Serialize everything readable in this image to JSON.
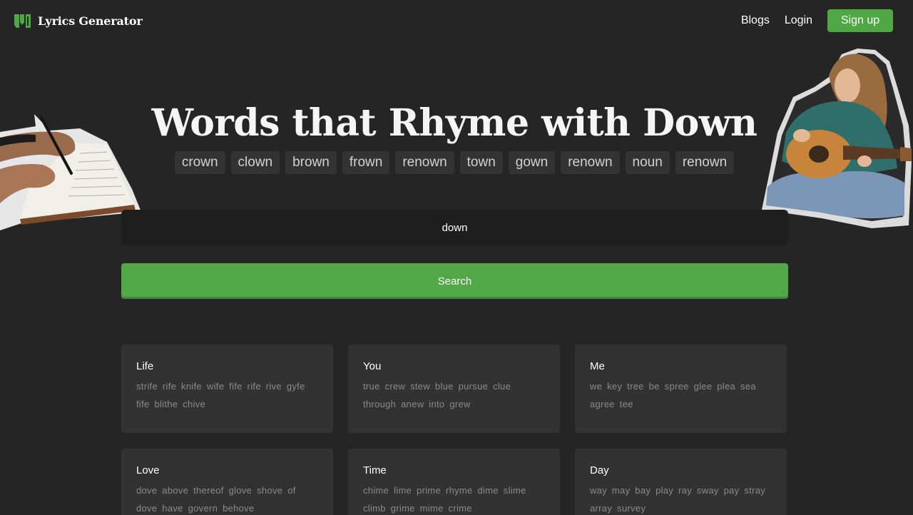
{
  "header": {
    "brand": "Lyrics Generator",
    "nav": {
      "blogs": "Blogs",
      "login": "Login",
      "signup": "Sign up"
    }
  },
  "hero": {
    "title": "Words that Rhyme with Down",
    "rhymes": [
      "crown",
      "clown",
      "brown",
      "frown",
      "renown",
      "town",
      "gown",
      "renown",
      "noun",
      "renown"
    ]
  },
  "search": {
    "value": "down",
    "button_label": "Search"
  },
  "cards": [
    {
      "title": "Life",
      "words": "strife rife knife wife fife rife rive gyfe fife blithe chive"
    },
    {
      "title": "You",
      "words": "true crew stew blue pursue clue through anew into grew"
    },
    {
      "title": "Me",
      "words": "we key tree be spree glee plea sea agree tee"
    },
    {
      "title": "Love",
      "words": "dove above thereof glove shove of dove have govern behove"
    },
    {
      "title": "Time",
      "words": "chime lime prime rhyme dime slime climb grime mime crime"
    },
    {
      "title": "Day",
      "words": "way may bay play ray sway pay stray array survey"
    }
  ],
  "colors": {
    "accent": "#4fa745",
    "background": "#252525",
    "card": "#323232"
  },
  "icons": {
    "logo": "lyrics-generator-logo-icon"
  }
}
